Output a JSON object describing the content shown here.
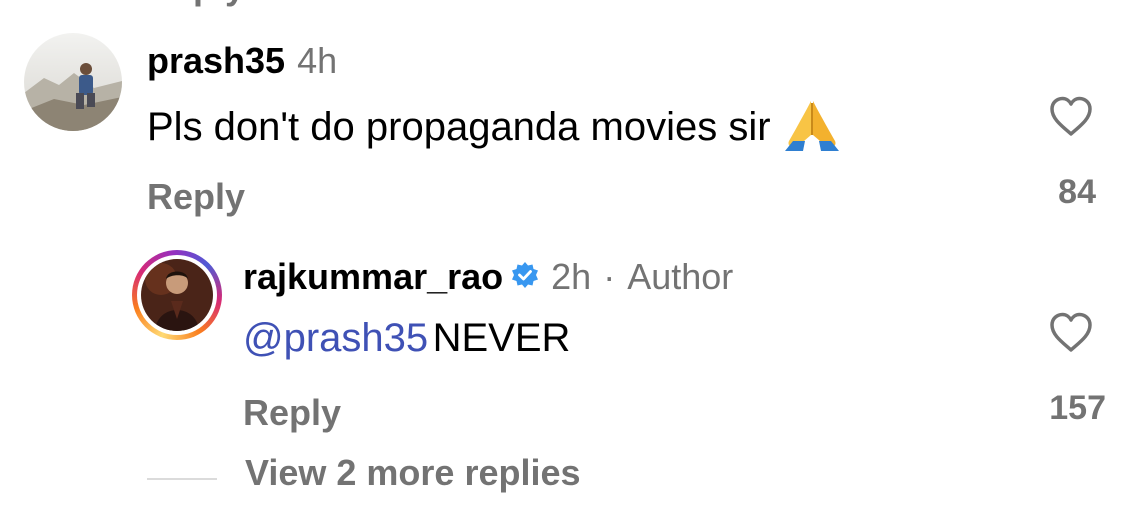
{
  "top_cutoff": {
    "reply_label": "Reply"
  },
  "comments": [
    {
      "username": "prash35",
      "time": "4h",
      "text": "Pls don't do propaganda movies sir",
      "emoji": "🙏",
      "reply_label": "Reply",
      "like_count": "84",
      "avatar_icon": "profile-photo"
    }
  ],
  "replies": [
    {
      "username": "rajkummar_rao",
      "verified": true,
      "time": "2h",
      "separator": "·",
      "role": "Author",
      "mention": "@prash35",
      "text": "NEVER",
      "reply_label": "Reply",
      "like_count": "157",
      "avatar_icon": "profile-photo-with-story-ring"
    }
  ],
  "view_more_label": "View 2 more replies",
  "colors": {
    "mention": "#3f51b5",
    "muted": "#737373",
    "verified": "#3897f0"
  }
}
